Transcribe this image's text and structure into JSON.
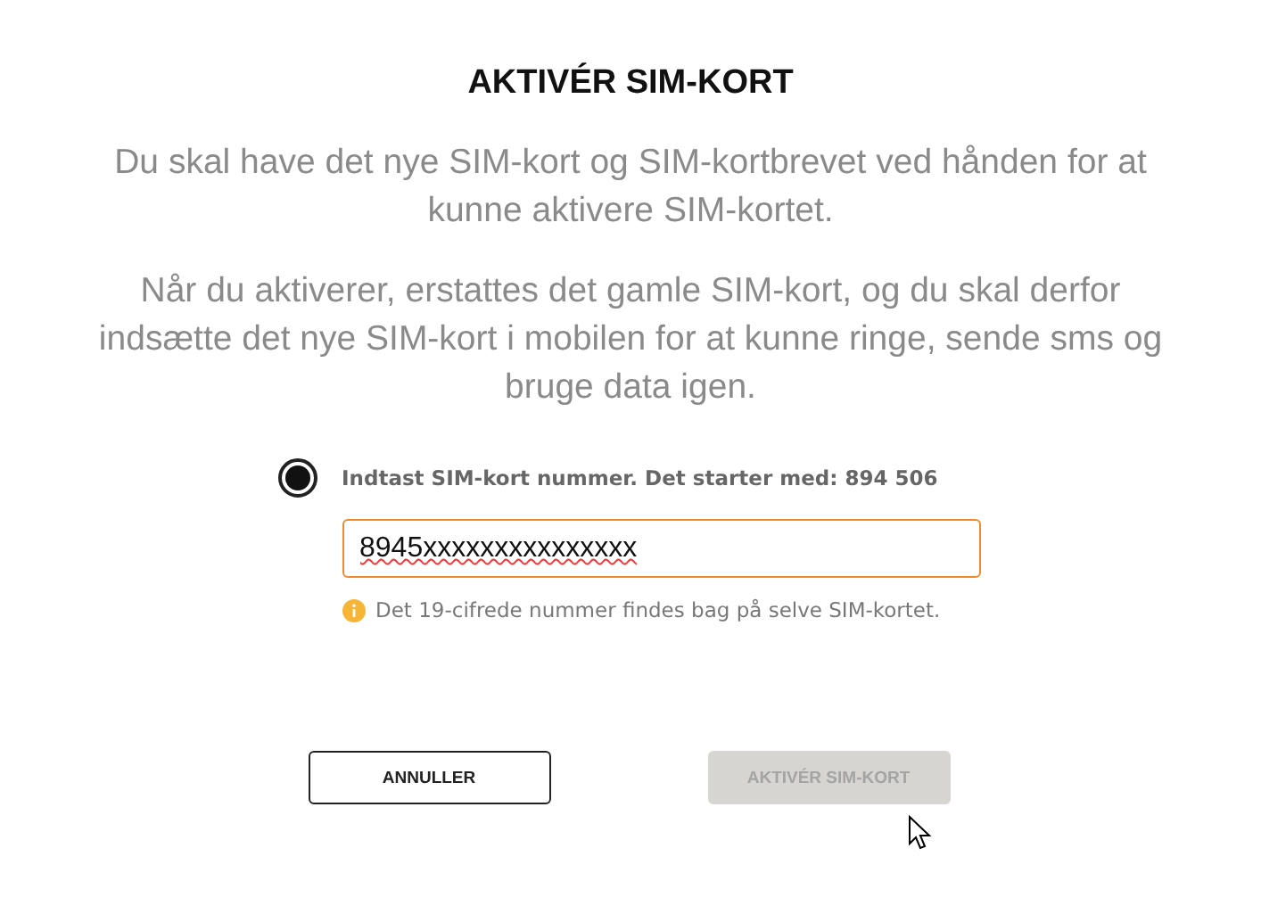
{
  "title": "AKTIVÉR SIM-KORT",
  "paragraphs": [
    "Du skal have det nye SIM-kort og SIM-kortbrevet ved hånden for at kunne aktivere SIM-kortet.",
    "Når du aktiverer, erstattes det gamle SIM-kort, og du skal derfor indsætte det nye SIM-kort i mobilen for at kunne ringe, sende sms og bruge data igen."
  ],
  "option": {
    "label": "Indtast SIM-kort nummer. Det starter med: 894 506",
    "selected": true
  },
  "sim_field": {
    "value": "8945xxxxxxxxxxxxxxx"
  },
  "hint": "Det 19-cifrede nummer findes bag på selve SIM-kortet.",
  "buttons": [
    {
      "label": "ANNULLER",
      "disabled": false
    },
    {
      "label": "AKTIVÉR SIM-KORT",
      "disabled": true
    }
  ]
}
